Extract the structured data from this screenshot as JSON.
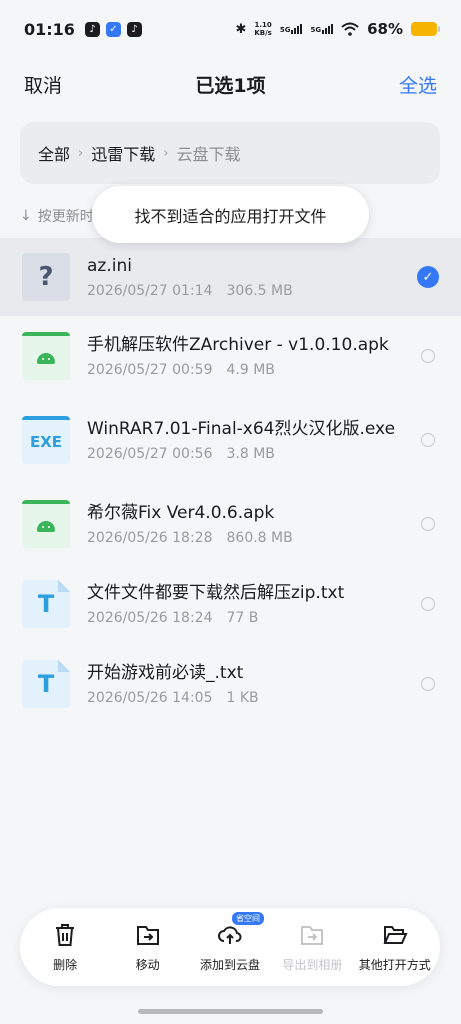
{
  "status_bar": {
    "time": "01:16",
    "speed_value": "1.10",
    "speed_unit": "KB/s",
    "signal_1": "5G",
    "signal_2": "5G",
    "battery": "68%"
  },
  "header": {
    "cancel_label": "取消",
    "title": "已选1项",
    "select_all_label": "全选"
  },
  "breadcrumb": {
    "items": [
      "全部",
      "迅雷下载",
      "云盘下载"
    ]
  },
  "sort": {
    "label": "按更新时间"
  },
  "toast": {
    "message": "找不到适合的应用打开文件"
  },
  "files": [
    {
      "name": "az.ini",
      "date": "2026/05/27 01:14",
      "size": "306.5 MB",
      "icon": "unknown-file-icon",
      "icon_text": "?",
      "selected": true
    },
    {
      "name": "手机解压软件ZArchiver - v1.0.10.apk",
      "date": "2026/05/27 00:59",
      "size": "4.9 MB",
      "icon": "android-apk-icon",
      "selected": false
    },
    {
      "name": "WinRAR7.01-Final-x64烈火汉化版.exe",
      "date": "2026/05/27 00:56",
      "size": "3.8 MB",
      "icon": "exe-file-icon",
      "icon_text": "EXE",
      "selected": false
    },
    {
      "name": "希尔薇Fix Ver4.0.6.apk",
      "date": "2026/05/26 18:28",
      "size": "860.8 MB",
      "icon": "android-apk-icon",
      "selected": false
    },
    {
      "name": "文件文件都要下载然后解压zip.txt",
      "date": "2026/05/26 18:24",
      "size": "77 B",
      "icon": "text-file-icon",
      "icon_text": "T",
      "selected": false
    },
    {
      "name": "开始游戏前必读_.txt",
      "date": "2026/05/26 14:05",
      "size": "1 KB",
      "icon": "text-file-icon",
      "icon_text": "T",
      "selected": false
    }
  ],
  "toolbar": {
    "delete_label": "删除",
    "move_label": "移动",
    "add_cloud_label": "添加到云盘",
    "add_cloud_badge": "省空间",
    "export_album_label": "导出到相册",
    "open_with_label": "其他打开方式"
  },
  "colors": {
    "accent": "#3478f6",
    "apk_green": "#3bb55a",
    "file_blue": "#2d9ee0"
  }
}
